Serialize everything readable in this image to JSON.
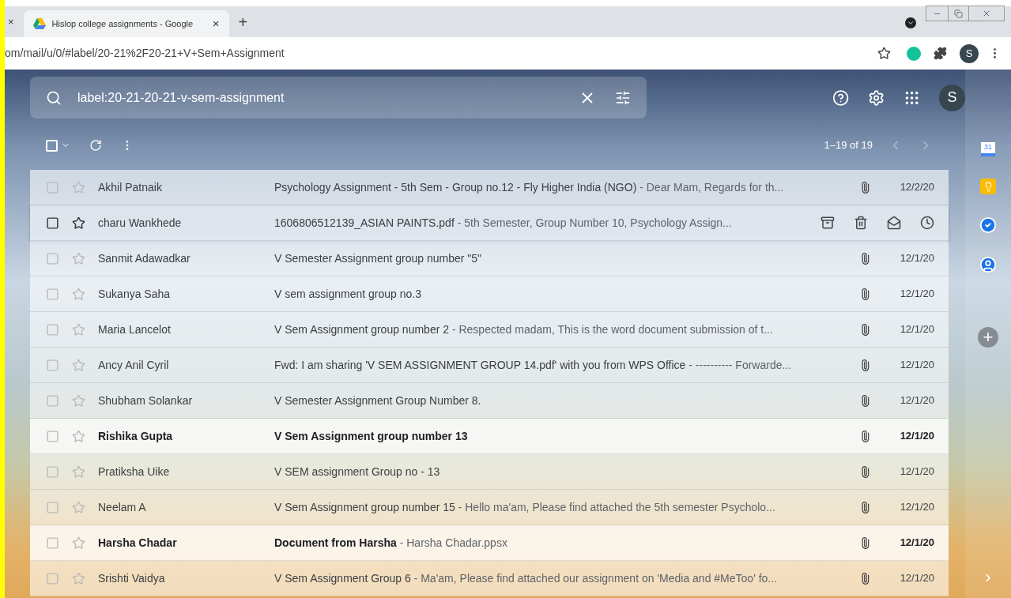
{
  "browser": {
    "prev_tab_close": "×",
    "tab": {
      "title": "Hislop college assignments - Google",
      "close": "×",
      "selected": true
    },
    "new_tab": "+",
    "address": "om/mail/u/0/#label/20-21%2F20-21+V+Sem+Assignment",
    "profile": "S"
  },
  "search": {
    "value": "label:20-21-20-21-v-sem-assignment"
  },
  "account": "S",
  "toolbar": {
    "select_all_checked": false,
    "count": "1–19 of 19"
  },
  "rows": [
    {
      "sender": "Akhil Patnaik",
      "subject": "Psychology Assignment - 5th Sem - Group no.12 - Fly Higher India (NGO)",
      "snippet": "- Dear Mam, Regards for th...",
      "date": "12/2/20",
      "unread": false,
      "hovered": false,
      "attachment": true
    },
    {
      "sender": "charu Wankhede",
      "subject": "1606806512139_ASIAN PAINTS.pdf",
      "snippet": "- 5th Semester, Group Number 10, Psychology Assign...",
      "unread": false,
      "hovered": true
    },
    {
      "sender": "Sanmit Adawadkar",
      "subject": "V Semester Assignment group number \"5\"",
      "date": "12/1/20",
      "unread": false,
      "hovered": false,
      "attachment": true
    },
    {
      "sender": "Sukanya Saha",
      "subject": "V sem assignment group no.3",
      "date": "12/1/20",
      "unread": false,
      "hovered": false,
      "attachment": true
    },
    {
      "sender": "Maria Lancelot",
      "subject": "V Sem Assignment group number 2",
      "snippet": "- Respected madam, This is the word document submission of t...",
      "date": "12/1/20",
      "unread": false,
      "hovered": false,
      "attachment": true
    },
    {
      "sender": "Ancy Anil Cyril",
      "subject": "Fwd: I am sharing 'V SEM ASSIGNMENT GROUP 14.pdf' with you from WPS Office",
      "snippet": "- ---------- Forwarde...",
      "date": "12/1/20",
      "unread": false,
      "hovered": false,
      "attachment": true
    },
    {
      "sender": "Shubham Solankar",
      "subject": "V Semester Assignment Group Number 8.",
      "date": "12/1/20",
      "unread": false,
      "hovered": false,
      "attachment": true
    },
    {
      "sender": "Rishika Gupta",
      "subject": "V Sem Assignment group number 13",
      "date": "12/1/20",
      "unread": true,
      "hovered": false,
      "attachment": true
    },
    {
      "sender": "Pratiksha Uike",
      "subject": "V SEM assignment Group no - 13",
      "date": "12/1/20",
      "unread": false,
      "hovered": false,
      "attachment": true
    },
    {
      "sender": "Neelam A",
      "subject": "V Sem Assignment group number 15",
      "snippet": "- Hello ma'am, Please find attached the 5th semester Psycholo...",
      "date": "12/1/20",
      "unread": false,
      "hovered": false,
      "attachment": true
    },
    {
      "sender": "Harsha Chadar",
      "subject": "Document from Harsha",
      "snippet": "- Harsha Chadar.ppsx",
      "date": "12/1/20",
      "unread": true,
      "hovered": false,
      "attachment": true
    },
    {
      "sender": "Srishti Vaidya",
      "subject": "V Sem Assignment Group 6",
      "snippet": "- Ma'am, Please find attached our assignment on 'Media and #MeToo' fo...",
      "date": "12/1/20",
      "unread": false,
      "hovered": false,
      "attachment": true
    }
  ],
  "side_panel": {
    "calendar_day": "31",
    "add": "+",
    "expand": "›"
  }
}
